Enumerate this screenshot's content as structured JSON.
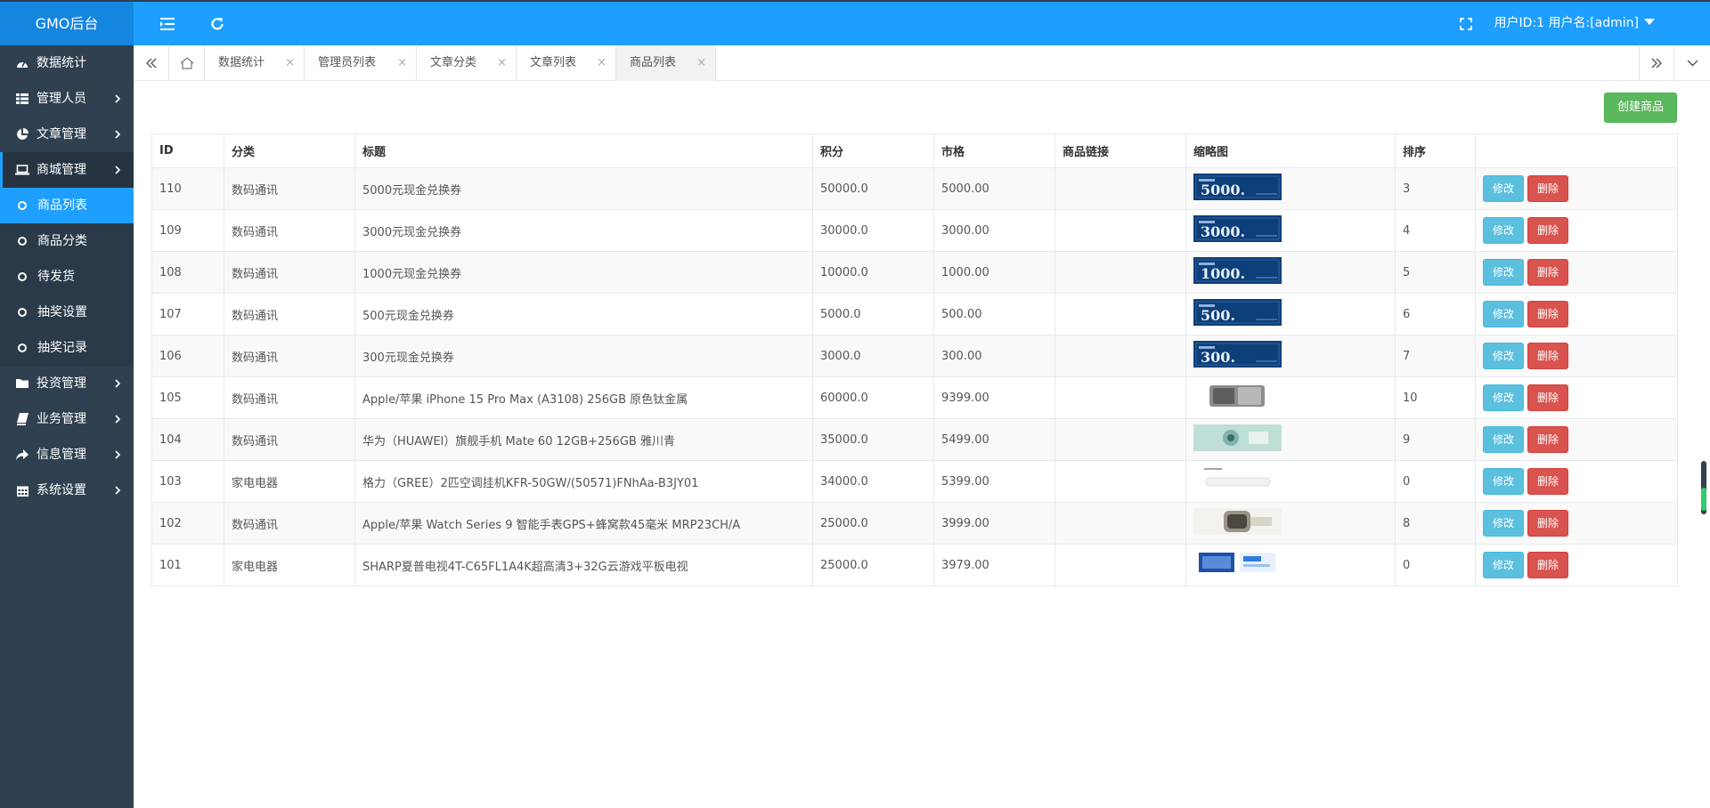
{
  "app": {
    "title": "GMO后台"
  },
  "header": {
    "user_text": "用户ID:1 用户名:[admin]"
  },
  "icons": {
    "collapse": "menu-collapse-icon",
    "refresh": "refresh-icon",
    "fullscreen": "fullscreen-icon",
    "home": "home-icon",
    "tab_prev": "double-chevron-left-icon",
    "tab_next": "double-chevron-right-icon",
    "tab_menu": "chevron-down-icon"
  },
  "sidebar": {
    "items": [
      {
        "label": "数据统计",
        "icon": "dashboard-icon",
        "has_children": false
      },
      {
        "label": "管理人员",
        "icon": "grid-icon",
        "has_children": true
      },
      {
        "label": "文章管理",
        "icon": "pie-chart-icon",
        "has_children": true
      },
      {
        "label": "商城管理",
        "icon": "laptop-icon",
        "has_children": true,
        "open": true
      },
      {
        "label": "投资管理",
        "icon": "folder-icon",
        "has_children": true
      },
      {
        "label": "业务管理",
        "icon": "book-icon",
        "has_children": true
      },
      {
        "label": "信息管理",
        "icon": "share-icon",
        "has_children": true
      },
      {
        "label": "系统设置",
        "icon": "calendar-icon",
        "has_children": true
      }
    ],
    "sub_items": [
      {
        "label": "商品列表",
        "active": true
      },
      {
        "label": "商品分类",
        "active": false
      },
      {
        "label": "待发货",
        "active": false
      },
      {
        "label": "抽奖设置",
        "active": false
      },
      {
        "label": "抽奖记录",
        "active": false
      }
    ]
  },
  "tabs": [
    {
      "label": "数据统计",
      "active": false
    },
    {
      "label": "管理员列表",
      "active": false
    },
    {
      "label": "文章分类",
      "active": false
    },
    {
      "label": "文章列表",
      "active": false
    },
    {
      "label": "商品列表",
      "active": true
    }
  ],
  "tab_close_glyph": "×",
  "toolbar": {
    "create_label": "创建商品"
  },
  "table": {
    "columns": [
      "ID",
      "分类",
      "标题",
      "积分",
      "市格",
      "商品链接",
      "缩略图",
      "排序",
      ""
    ],
    "edit_label": "修改",
    "delete_label": "删除",
    "rows": [
      {
        "id": "110",
        "category": "数码通讯",
        "title": "5000元现金兑换券",
        "points": "50000.0",
        "price": "5000.00",
        "link": "",
        "thumb_text": "5000.",
        "thumb_style": "voucher",
        "sort": "3"
      },
      {
        "id": "109",
        "category": "数码通讯",
        "title": "3000元现金兑换券",
        "points": "30000.0",
        "price": "3000.00",
        "link": "",
        "thumb_text": "3000.",
        "thumb_style": "voucher",
        "sort": "4"
      },
      {
        "id": "108",
        "category": "数码通讯",
        "title": "1000元现金兑换券",
        "points": "10000.0",
        "price": "1000.00",
        "link": "",
        "thumb_text": "1000.",
        "thumb_style": "voucher",
        "sort": "5"
      },
      {
        "id": "107",
        "category": "数码通讯",
        "title": "500元现金兑换券",
        "points": "5000.0",
        "price": "500.00",
        "link": "",
        "thumb_text": "500.",
        "thumb_style": "voucher",
        "sort": "6"
      },
      {
        "id": "106",
        "category": "数码通讯",
        "title": "300元现金兑换券",
        "points": "3000.0",
        "price": "300.00",
        "link": "",
        "thumb_text": "300.",
        "thumb_style": "voucher",
        "sort": "7"
      },
      {
        "id": "105",
        "category": "数码通讯",
        "title": "Apple/苹果 iPhone 15 Pro Max (A3108) 256GB 原色钛金属",
        "points": "60000.0",
        "price": "9399.00",
        "link": "",
        "thumb_text": "",
        "thumb_style": "phone",
        "sort": "10"
      },
      {
        "id": "104",
        "category": "数码通讯",
        "title": "华为（HUAWEI）旗舰手机 Mate 60 12GB+256GB 雅川青",
        "points": "35000.0",
        "price": "5499.00",
        "link": "",
        "thumb_text": "",
        "thumb_style": "mate",
        "sort": "9"
      },
      {
        "id": "103",
        "category": "家电电器",
        "title": "格力（GREE）2匹空调挂机KFR-50GW/(50571)FNhAa-B3JY01",
        "points": "34000.0",
        "price": "5399.00",
        "link": "",
        "thumb_text": "",
        "thumb_style": "ac",
        "sort": "0"
      },
      {
        "id": "102",
        "category": "数码通讯",
        "title": "Apple/苹果 Watch Series 9 智能手表GPS+蜂窝款45毫米 MRP23CH/A",
        "points": "25000.0",
        "price": "3999.00",
        "link": "",
        "thumb_text": "",
        "thumb_style": "watch",
        "sort": "8"
      },
      {
        "id": "101",
        "category": "家电电器",
        "title": "SHARP夏普电视4T-C65FL1A4K超高清3+32G云游戏平板电视",
        "points": "25000.0",
        "price": "3979.00",
        "link": "",
        "thumb_text": "",
        "thumb_style": "tv",
        "sort": "0"
      }
    ]
  }
}
